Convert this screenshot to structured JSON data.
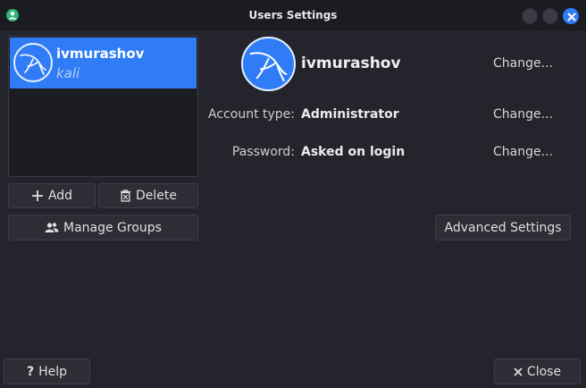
{
  "window": {
    "title": "Users Settings",
    "app_icon": "user-icon",
    "controls": [
      "minimize",
      "maximize",
      "close-icon"
    ]
  },
  "user_list": {
    "items": [
      {
        "name": "ivmurashov",
        "subtitle": "kali",
        "avatar": "kali-dragon-icon",
        "selected": true
      }
    ]
  },
  "list_actions": {
    "add_label": "Add",
    "delete_label": "Delete",
    "manage_groups_label": "Manage Groups"
  },
  "details": {
    "username": "ivmurashov",
    "account_type_label": "Account type:",
    "account_type_value": "Administrator",
    "password_label": "Password:",
    "password_value": "Asked on login",
    "change_name_label": "Change...",
    "change_account_type_label": "Change...",
    "change_password_label": "Change...",
    "advanced_label": "Advanced Settings"
  },
  "footer": {
    "help_label": "Help",
    "close_label": "Close"
  },
  "colors": {
    "accent": "#2f7cf6",
    "background": "#23242c",
    "titlebar": "#1b1c22"
  }
}
